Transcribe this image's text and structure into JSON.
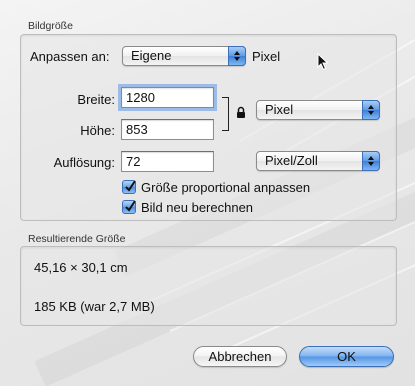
{
  "image_size": {
    "title": "Bildgröße",
    "fit_label": "Anpassen an:",
    "fit_value": "Eigene",
    "fit_unit": "Pixel",
    "width_label": "Breite:",
    "width_value": "1280",
    "height_label": "Höhe:",
    "height_value": "853",
    "size_unit": "Pixel",
    "resolution_label": "Auflösung:",
    "resolution_value": "72",
    "resolution_unit": "Pixel/Zoll",
    "proportional_label": "Größe proportional anpassen",
    "proportional_checked": true,
    "resample_label": "Bild neu berechnen",
    "resample_checked": true
  },
  "result": {
    "title": "Resultierende Größe",
    "dimensions": "45,16 × 30,1 cm",
    "filesize": "185 KB (war 2,7 MB)"
  },
  "buttons": {
    "cancel": "Abbrechen",
    "ok": "OK"
  },
  "icons": {
    "lock": "lock-icon",
    "cursor": "mouse-cursor-icon",
    "checkmark": "checkmark-icon"
  },
  "colors": {
    "accent": "#5d9ae6",
    "focus_ring": "#5f96e6"
  }
}
